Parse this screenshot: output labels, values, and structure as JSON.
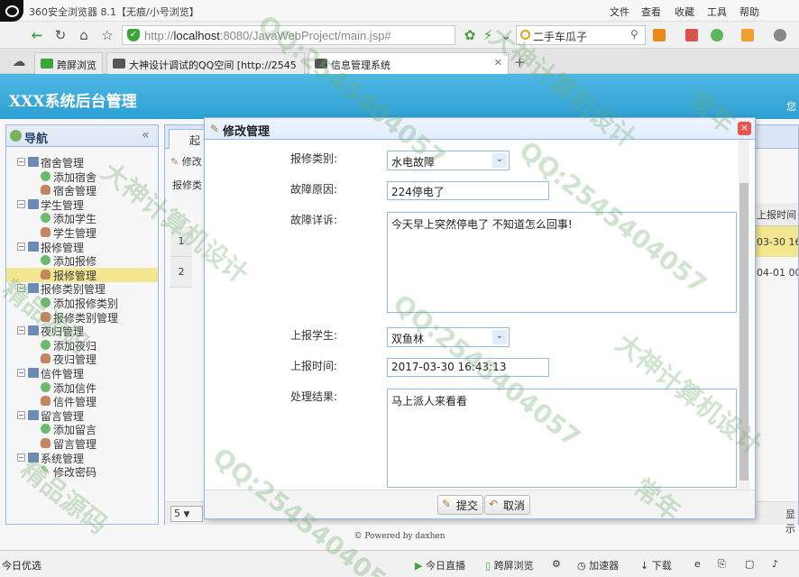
{
  "browser": {
    "title": "360安全浏览器 8.1【无痕/小号浏览】",
    "menu": [
      "文件",
      "查看",
      "收藏",
      "工具",
      "帮助"
    ],
    "url_host": "localhost",
    "url_rest": ":8080/JavaWebProject/main.jsp#",
    "url_prefix": "http://",
    "search_text": "二手车瓜子",
    "tabs": [
      {
        "label": "跨屏浏览"
      },
      {
        "label": "大神设计调试的QQ空间 [http://2545"
      },
      {
        "label": "信息管理系统"
      }
    ],
    "new_tab": "+"
  },
  "app": {
    "header_title": "XXX系统后台管理",
    "header_right": "您",
    "footer": "© Powered by daxhen"
  },
  "sidebar": {
    "title": "导航",
    "collapse": "«",
    "items": [
      {
        "label": "宿舍管理",
        "level": 0
      },
      {
        "label": "添加宿舍",
        "level": 1,
        "icon": "add"
      },
      {
        "label": "宿舍管理",
        "level": 1,
        "icon": "user"
      },
      {
        "label": "学生管理",
        "level": 0
      },
      {
        "label": "添加学生",
        "level": 1,
        "icon": "add"
      },
      {
        "label": "学生管理",
        "level": 1,
        "icon": "user"
      },
      {
        "label": "报修管理",
        "level": 0
      },
      {
        "label": "添加报修",
        "level": 1,
        "icon": "add"
      },
      {
        "label": "报修管理",
        "level": 1,
        "icon": "user",
        "selected": true
      },
      {
        "label": "报修类别管理",
        "level": 0
      },
      {
        "label": "添加报修类别",
        "level": 1,
        "icon": "add"
      },
      {
        "label": "报修类别管理",
        "level": 1,
        "icon": "user"
      },
      {
        "label": "夜归管理",
        "level": 0
      },
      {
        "label": "添加夜归",
        "level": 1,
        "icon": "add"
      },
      {
        "label": "夜归管理",
        "level": 1,
        "icon": "user"
      },
      {
        "label": "信件管理",
        "level": 0
      },
      {
        "label": "添加信件",
        "level": 1,
        "icon": "add"
      },
      {
        "label": "信件管理",
        "level": 1,
        "icon": "user"
      },
      {
        "label": "留言管理",
        "level": 0
      },
      {
        "label": "添加留言",
        "level": 1,
        "icon": "add"
      },
      {
        "label": "留言管理",
        "level": 1,
        "icon": "user"
      },
      {
        "label": "系统管理",
        "level": 0
      },
      {
        "label": "修改密码",
        "level": 1,
        "icon": "pen"
      }
    ]
  },
  "main": {
    "tab": "起",
    "tool": "修改",
    "filter": "报修类",
    "col_header": "上报时间",
    "rows": [
      {
        "no": "1",
        "time": "03-30 16"
      },
      {
        "no": "2",
        "time": "04-01 00"
      }
    ],
    "page_size": "5",
    "pager_right": "显示"
  },
  "dialog": {
    "title": "修改管理",
    "close": "×",
    "fields": {
      "repair_type_label": "报修类别:",
      "repair_type_value": "水电故障",
      "reason_label": "故障原因:",
      "reason_value": "224停电了",
      "detail_label": "故障详诉:",
      "detail_value": "今天早上突然停电了 不知道怎么回事!",
      "student_label": "上报学生:",
      "student_value": "双鱼林",
      "time_label": "上报时间:",
      "time_value": "2017-03-30 16:43:13",
      "result_label": "处理结果:",
      "result_value": "马上派人来看看"
    },
    "submit": "提交",
    "cancel": "取消"
  },
  "statusbar": {
    "left": "今日优选",
    "items": [
      "今日直播",
      "跨屏浏览",
      "加速器",
      "下载"
    ]
  },
  "watermark": [
    "QQ:2545404057",
    "大神计算机设计",
    "精品源码",
    "常年"
  ]
}
